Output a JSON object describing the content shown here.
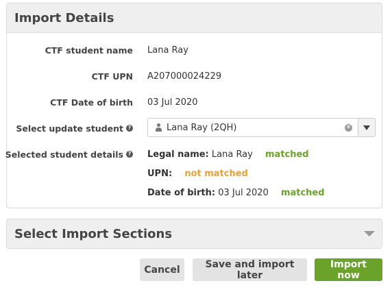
{
  "import_details": {
    "title": "Import Details",
    "ctf_name_label": "CTF student name",
    "ctf_name_value": "Lana Ray",
    "ctf_upn_label": "CTF UPN",
    "ctf_upn_value": "A207000024229",
    "ctf_dob_label": "CTF Date of birth",
    "ctf_dob_value": "03 Jul 2020",
    "update_student_label": "Select update student",
    "update_student_value": "Lana Ray (2QH)",
    "selected_details_label": "Selected student details",
    "legal_name_key": "Legal name:",
    "legal_name_value": "Lana Ray",
    "legal_name_status": "matched",
    "upn_key": "UPN:",
    "upn_status": "not matched",
    "dob_key": "Date of birth:",
    "dob_value": "03 Jul 2020",
    "dob_status": "matched"
  },
  "sections": {
    "title": "Select Import Sections"
  },
  "buttons": {
    "cancel": "Cancel",
    "save_later": "Save and import later",
    "import_now": "Import now"
  },
  "colors": {
    "matched": "#6aa22a",
    "not_matched": "#e8a13a",
    "primary": "#6ba32a"
  },
  "icons": {
    "help": "question-circle-icon",
    "person": "user-icon",
    "clear": "clear-icon",
    "dropdown": "caret-down-icon"
  }
}
